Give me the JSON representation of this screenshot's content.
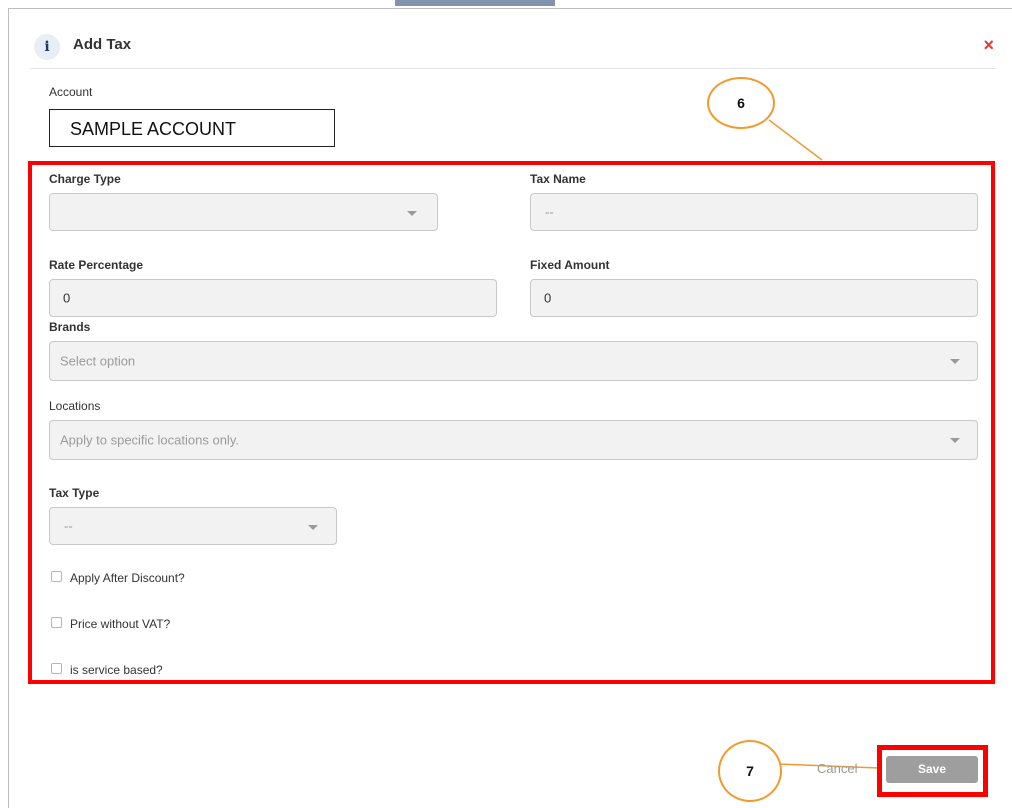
{
  "dialog": {
    "title": "Add Tax",
    "close_label": "×",
    "info_label": "i"
  },
  "account": {
    "label": "Account",
    "value": "SAMPLE ACCOUNT"
  },
  "form": {
    "charge_type_label": "Charge Type",
    "tax_name_label": "Tax Name",
    "tax_name_placeholder": "--",
    "rate_percentage_label": "Rate Percentage",
    "rate_percentage_value": "0",
    "fixed_amount_label": "Fixed Amount",
    "fixed_amount_value": "0",
    "brands_label": "Brands",
    "brands_placeholder": "Select option",
    "locations_label": "Locations",
    "locations_placeholder": "Apply to specific locations only.",
    "tax_type_label": "Tax Type",
    "tax_type_value": "--",
    "checkboxes": [
      {
        "label": "Apply After Discount?",
        "checked": false
      },
      {
        "label": "Price without VAT?",
        "checked": false
      },
      {
        "label": "is service based?",
        "checked": false
      }
    ]
  },
  "footer": {
    "cancel_label": "Cancel",
    "save_label": "Save"
  },
  "callouts": {
    "six": "6",
    "seven": "7"
  },
  "colors": {
    "highlight_red": "#ff0000",
    "callout_orange": "#f29a2e",
    "close_red": "#e53935",
    "save_gray": "#9e9e9e"
  }
}
